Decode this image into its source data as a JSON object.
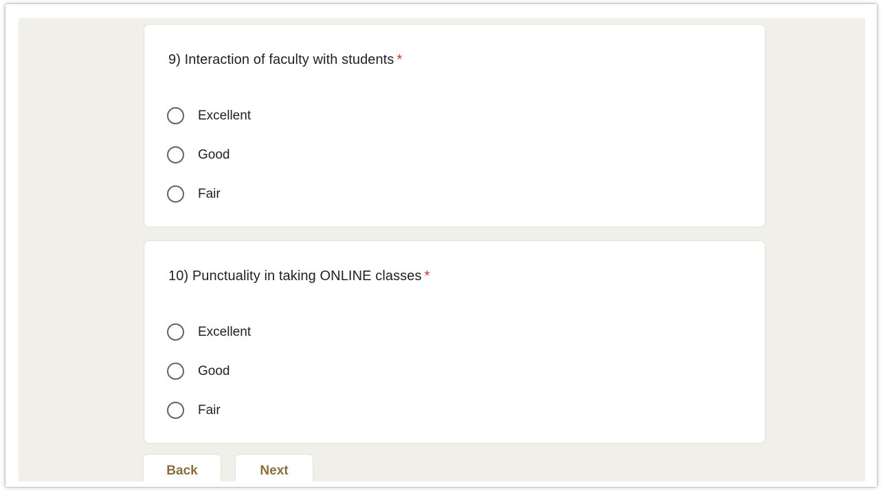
{
  "questions": [
    {
      "title": "9) Interaction of faculty with students",
      "required_mark": "*",
      "options": [
        "Excellent",
        "Good",
        "Fair"
      ]
    },
    {
      "title": "10) Punctuality in taking ONLINE classes",
      "required_mark": "*",
      "options": [
        "Excellent",
        "Good",
        "Fair"
      ]
    }
  ],
  "navigation": {
    "back_label": "Back",
    "next_label": "Next"
  },
  "colors": {
    "background": "#f0efea",
    "card": "#ffffff",
    "required": "#d93025",
    "button_text": "#8a6d3b"
  }
}
